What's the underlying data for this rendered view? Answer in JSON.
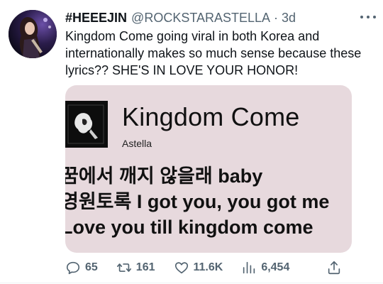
{
  "tweet": {
    "display_name": "#HEEEJIN",
    "handle": "@ROCKSTARASTELLA",
    "separator": "·",
    "time": "3d",
    "text": "Kingdom Come going viral in both Korea and internationally makes so much sense because these lyrics?? SHE'S IN LOVE YOUR HONOR!",
    "more_icon": "more-horizontal-icon"
  },
  "card": {
    "song_title": "Kingdom Come",
    "artist": "Astella",
    "background_color": "#e7d9dd",
    "lyrics": [
      "꿈에서 깨지 않을래 baby",
      "영원토록 I got you, you got me",
      "Love you till kingdom come"
    ]
  },
  "actions": {
    "reply": {
      "icon": "reply-icon",
      "count": "65"
    },
    "retweet": {
      "icon": "retweet-icon",
      "count": "161"
    },
    "like": {
      "icon": "heart-icon",
      "count": "11.6K"
    },
    "views": {
      "icon": "views-icon",
      "count": "6,454"
    },
    "share": {
      "icon": "share-icon"
    }
  },
  "colors": {
    "text_primary": "#0f1419",
    "text_secondary": "#536471"
  }
}
